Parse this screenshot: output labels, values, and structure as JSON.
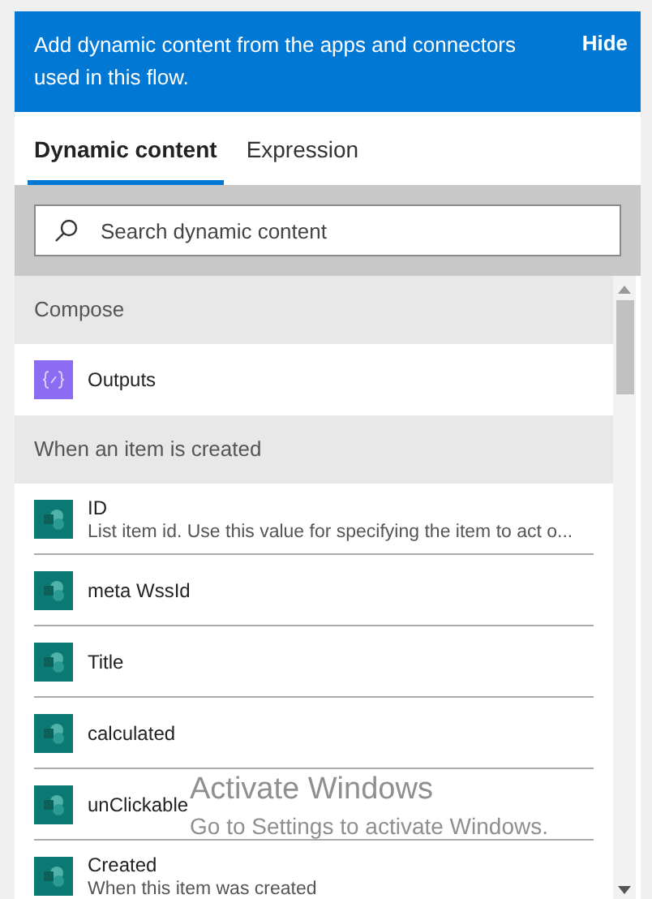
{
  "banner": {
    "text": "Add dynamic content from the apps and connectors used in this flow.",
    "hide_label": "Hide"
  },
  "tabs": [
    {
      "label": "Dynamic content",
      "selected": true
    },
    {
      "label": "Expression",
      "selected": false
    }
  ],
  "search": {
    "placeholder": "Search dynamic content"
  },
  "sections": [
    {
      "title": "Compose",
      "items": [
        {
          "name": "Outputs",
          "kind": "compose"
        }
      ]
    },
    {
      "title": "When an item is created",
      "items": [
        {
          "name": "ID",
          "description": "List item id. Use this value for specifying the item to act o...",
          "kind": "sharepoint"
        },
        {
          "name": "meta WssId",
          "kind": "sharepoint"
        },
        {
          "name": "Title",
          "kind": "sharepoint"
        },
        {
          "name": "calculated",
          "kind": "sharepoint"
        },
        {
          "name": "unClickable",
          "kind": "sharepoint"
        },
        {
          "name": "Created",
          "description": "When this item was created",
          "kind": "sharepoint"
        }
      ]
    }
  ],
  "os_watermark": {
    "title": "Activate Windows",
    "subtitle": "Go to Settings to activate Windows."
  }
}
